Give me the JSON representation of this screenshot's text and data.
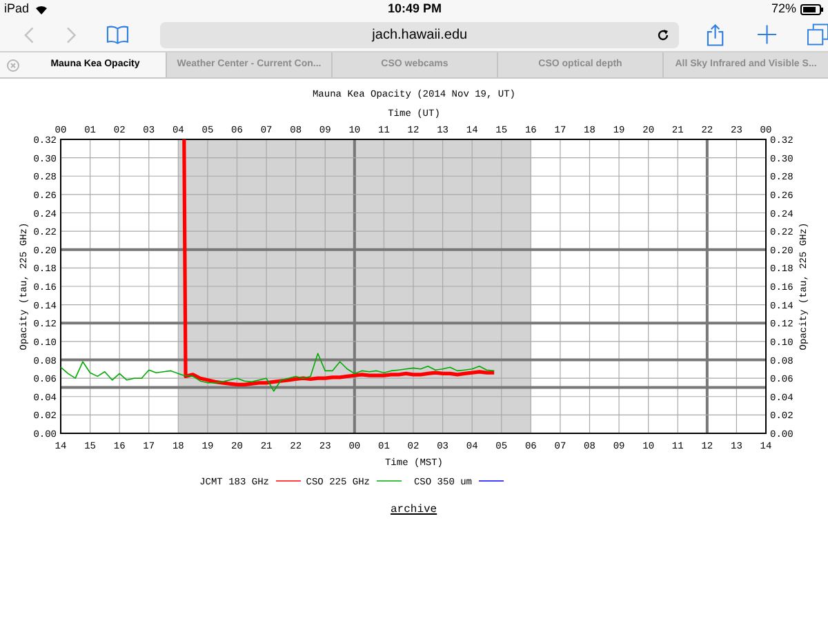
{
  "status_bar": {
    "device": "iPad",
    "time": "10:49 PM",
    "battery": "72%"
  },
  "toolbar": {
    "url": "jach.hawaii.edu"
  },
  "tabs": [
    {
      "label": "Mauna Kea Opacity",
      "selected": true
    },
    {
      "label": "Weather Center - Current Con...",
      "selected": false
    },
    {
      "label": "CSO webcams",
      "selected": false
    },
    {
      "label": "CSO optical depth",
      "selected": false
    },
    {
      "label": "All Sky Infrared and Visible S...",
      "selected": false
    }
  ],
  "chart": {
    "top_axis_title": "Time (UT)",
    "top_axis_labels": [
      "00",
      "01",
      "02",
      "03",
      "04",
      "05",
      "06",
      "07",
      "08",
      "09",
      "10",
      "11",
      "12",
      "13",
      "14",
      "15",
      "16",
      "17",
      "18",
      "19",
      "20",
      "21",
      "22",
      "23",
      "00"
    ],
    "right_ylabel": "Opacity (tau, 225 GHz)",
    "chart_data": {
      "type": "line",
      "title": "Mauna Kea Opacity (2014 Nov 19, UT)",
      "xlabel": "Time (MST)",
      "ylabel": "Opacity (tau, 225 GHz)",
      "x": [
        14,
        14.25,
        14.5,
        14.75,
        15,
        15.25,
        15.5,
        15.75,
        16,
        16.25,
        16.5,
        16.75,
        17,
        17.25,
        17.5,
        17.75,
        18,
        18.2,
        18.25,
        18.5,
        18.75,
        19,
        19.25,
        19.5,
        19.75,
        20,
        20.25,
        20.5,
        20.75,
        21,
        21.25,
        21.5,
        21.75,
        22,
        22.25,
        22.5,
        22.75,
        23,
        23.25,
        23.5,
        23.75,
        24,
        24.25,
        24.5,
        24.75,
        25,
        25.25,
        25.5,
        25.75,
        26,
        26.25,
        26.5,
        26.75,
        27,
        27.25,
        27.5,
        27.75,
        28,
        28.25,
        28.5,
        28.75
      ],
      "series": [
        {
          "name": "JCMT 183 GHz",
          "color": "#ff0000",
          "values": [
            null,
            null,
            null,
            null,
            null,
            null,
            null,
            null,
            null,
            null,
            null,
            null,
            null,
            null,
            null,
            null,
            null,
            0.32,
            0.062,
            0.064,
            0.06,
            0.058,
            0.056,
            0.055,
            0.054,
            0.053,
            0.053,
            0.054,
            0.055,
            0.055,
            0.056,
            0.057,
            0.058,
            0.059,
            0.06,
            0.059,
            0.06,
            0.06,
            0.061,
            0.061,
            0.062,
            0.063,
            0.064,
            0.063,
            0.063,
            0.063,
            0.064,
            0.064,
            0.065,
            0.064,
            0.064,
            0.065,
            0.066,
            0.065,
            0.065,
            0.064,
            0.065,
            0.066,
            0.067,
            0.066,
            0.066
          ]
        },
        {
          "name": "CSO 225 GHz",
          "color": "#00aa00",
          "values": [
            0.072,
            0.065,
            0.06,
            0.078,
            0.066,
            0.062,
            0.067,
            0.058,
            0.065,
            0.058,
            0.06,
            0.06,
            0.069,
            0.066,
            0.067,
            0.068,
            0.065,
            0.063,
            0.063,
            0.062,
            0.057,
            0.055,
            0.055,
            0.056,
            0.058,
            0.06,
            0.057,
            0.056,
            0.058,
            0.06,
            0.046,
            0.058,
            0.06,
            0.062,
            0.06,
            0.062,
            0.087,
            0.068,
            0.068,
            0.078,
            0.07,
            0.065,
            0.068,
            0.067,
            0.068,
            0.066,
            0.068,
            0.069,
            0.07,
            0.071,
            0.07,
            0.073,
            0.069,
            0.07,
            0.072,
            0.068,
            0.069,
            0.07,
            0.073,
            0.069,
            0.068
          ]
        },
        {
          "name": "CSO 350 um",
          "color": "#0000ff",
          "values": [
            null,
            null,
            null,
            null,
            null,
            null,
            null,
            null,
            null,
            null,
            null,
            null,
            null,
            null,
            null,
            null,
            null,
            null,
            null,
            null,
            null,
            null,
            null,
            null,
            null,
            null,
            null,
            null,
            null,
            null,
            null,
            null,
            null,
            null,
            null,
            null,
            null,
            null,
            null,
            null,
            null,
            null,
            null,
            null,
            null,
            null,
            null,
            null,
            null,
            null,
            null,
            null,
            null,
            null,
            null,
            null,
            null,
            null,
            null,
            null,
            null
          ]
        }
      ],
      "xlim": [
        14,
        38
      ],
      "ylim": [
        0,
        0.32
      ],
      "xticks": [
        {
          "value": 14,
          "label": "14"
        },
        {
          "value": 15,
          "label": "15"
        },
        {
          "value": 16,
          "label": "16"
        },
        {
          "value": 17,
          "label": "17"
        },
        {
          "value": 18,
          "label": "18"
        },
        {
          "value": 19,
          "label": "19"
        },
        {
          "value": 20,
          "label": "20"
        },
        {
          "value": 21,
          "label": "21"
        },
        {
          "value": 22,
          "label": "22"
        },
        {
          "value": 23,
          "label": "23"
        },
        {
          "value": 24,
          "label": "00"
        },
        {
          "value": 25,
          "label": "01"
        },
        {
          "value": 26,
          "label": "02"
        },
        {
          "value": 27,
          "label": "03"
        },
        {
          "value": 28,
          "label": "04"
        },
        {
          "value": 29,
          "label": "05"
        },
        {
          "value": 30,
          "label": "06"
        },
        {
          "value": 31,
          "label": "07"
        },
        {
          "value": 32,
          "label": "08"
        },
        {
          "value": 33,
          "label": "09"
        },
        {
          "value": 34,
          "label": "10"
        },
        {
          "value": 35,
          "label": "11"
        },
        {
          "value": 36,
          "label": "12"
        },
        {
          "value": 37,
          "label": "13"
        },
        {
          "value": 38,
          "label": "14"
        }
      ],
      "yticks": [
        {
          "value": 0,
          "label": "0.00"
        },
        {
          "value": 0.02,
          "label": "0.02"
        },
        {
          "value": 0.04,
          "label": "0.04"
        },
        {
          "value": 0.06,
          "label": "0.06"
        },
        {
          "value": 0.08,
          "label": "0.08"
        },
        {
          "value": 0.1,
          "label": "0.10"
        },
        {
          "value": 0.12,
          "label": "0.12"
        },
        {
          "value": 0.14,
          "label": "0.14"
        },
        {
          "value": 0.16,
          "label": "0.16"
        },
        {
          "value": 0.18,
          "label": "0.18"
        },
        {
          "value": 0.2,
          "label": "0.20"
        },
        {
          "value": 0.22,
          "label": "0.22"
        },
        {
          "value": 0.24,
          "label": "0.24"
        },
        {
          "value": 0.26,
          "label": "0.26"
        },
        {
          "value": 0.28,
          "label": "0.28"
        },
        {
          "value": 0.3,
          "label": "0.30"
        },
        {
          "value": 0.32,
          "label": "0.32"
        }
      ],
      "grid": true,
      "legend": true,
      "bands": [
        {
          "axis": "x",
          "from": 18,
          "to": 30
        }
      ],
      "ref_lines": [
        {
          "axis": "y",
          "value": 0.05
        }
      ]
    }
  },
  "archive_link": "archive"
}
